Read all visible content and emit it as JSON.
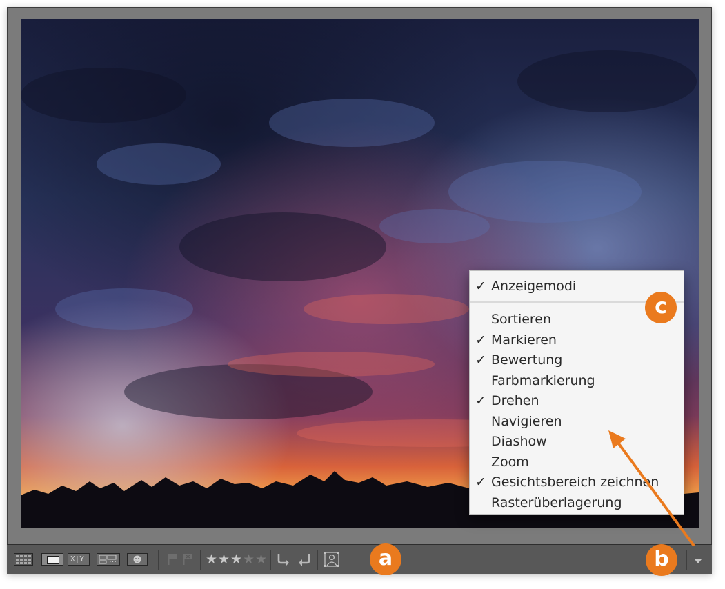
{
  "toolbar": {
    "compare_label": "X|Y",
    "survey_label": "…"
  },
  "menu": {
    "header": {
      "label": "Anzeigemodi",
      "checked": true
    },
    "items": [
      {
        "label": "Sortieren",
        "checked": false
      },
      {
        "label": "Markieren",
        "checked": true
      },
      {
        "label": "Bewertung",
        "checked": true
      },
      {
        "label": "Farbmarkierung",
        "checked": false
      },
      {
        "label": "Drehen",
        "checked": true
      },
      {
        "label": "Navigieren",
        "checked": false
      },
      {
        "label": "Diashow",
        "checked": false
      },
      {
        "label": "Zoom",
        "checked": false
      },
      {
        "label": "Gesichtsbereich zeichnen",
        "checked": true
      },
      {
        "label": "Rasterüberlagerung",
        "checked": false
      }
    ]
  },
  "rating": {
    "value": 3,
    "max": 5
  },
  "callouts": {
    "a": "a",
    "b": "b",
    "c": "c"
  },
  "colors": {
    "accent": "#ea7a1e",
    "toolbar": "#585858",
    "menu_bg": "#f5f5f5"
  },
  "icons": {
    "grid": "grid-view-icon",
    "loupe": "loupe-view-icon",
    "compare": "compare-view-icon",
    "survey": "survey-view-icon",
    "people": "people-view-icon",
    "flag": "flag-icon",
    "reject": "reject-flag-icon",
    "star": "star-icon",
    "rotate_left": "rotate-left-icon",
    "rotate_right": "rotate-right-icon",
    "face": "face-region-icon",
    "dropdown": "toolbar-menu-triangle-icon"
  }
}
